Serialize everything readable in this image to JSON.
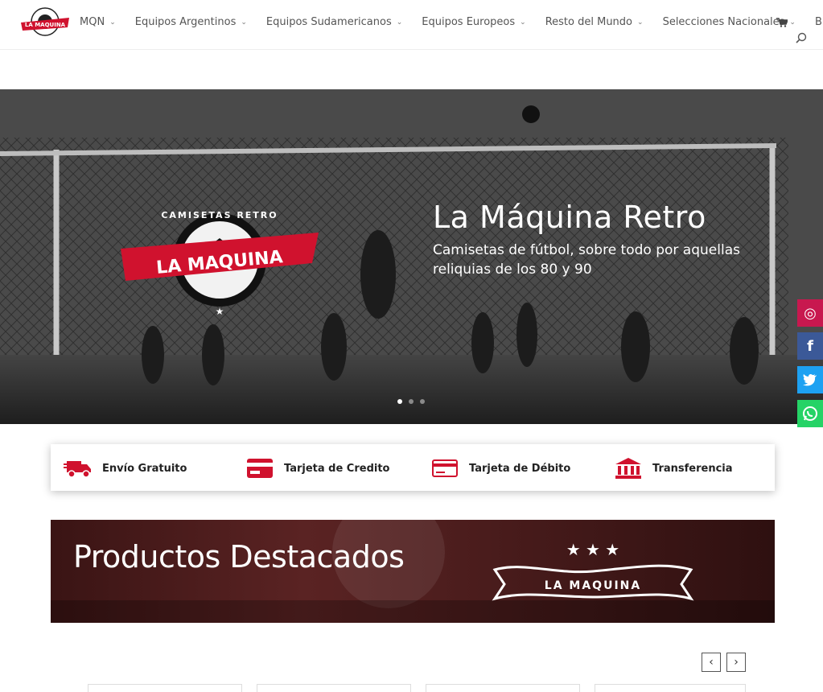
{
  "nav": {
    "items": [
      {
        "label": "MQN",
        "has_dropdown": true
      },
      {
        "label": "Equipos Argentinos",
        "has_dropdown": true
      },
      {
        "label": "Equipos Sudamericanos",
        "has_dropdown": true
      },
      {
        "label": "Equipos Europeos",
        "has_dropdown": true
      },
      {
        "label": "Resto del Mundo",
        "has_dropdown": true
      },
      {
        "label": "Selecciones Nacionales",
        "has_dropdown": true
      }
    ],
    "blog_label": "Blog",
    "cart_icon": "cart-icon",
    "search_icon": "search-icon"
  },
  "hero": {
    "title": "La Máquina Retro",
    "subtitle": "Camisetas de fútbol, sobre todo por aquellas reliquias de los 80 y 90",
    "emblem_text_top": "CAMISETAS RETRO",
    "emblem_banner": "LA MAQUINA",
    "slides": 3,
    "active_slide": 1
  },
  "social": [
    {
      "name": "instagram-icon",
      "glyph": "◎",
      "color": "#c8184f"
    },
    {
      "name": "facebook-icon",
      "glyph": "f",
      "color": "#3b5998"
    },
    {
      "name": "twitter-icon",
      "glyph": "🐦",
      "color": "#1da1f2"
    },
    {
      "name": "whatsapp-icon",
      "glyph": "✆",
      "color": "#25d366"
    }
  ],
  "features": [
    {
      "label": "Envío Gratuito",
      "icon": "truck-icon"
    },
    {
      "label": "Tarjeta de Credito",
      "icon": "credit-card-icon"
    },
    {
      "label": "Tarjeta de Débito",
      "icon": "debit-card-icon"
    },
    {
      "label": "Transferencia",
      "icon": "bank-icon"
    }
  ],
  "featured": {
    "title": "Productos Destacados",
    "logo_text": "LA MAQUINA"
  },
  "carousel": {
    "prev_glyph": "‹",
    "next_glyph": "›"
  },
  "colors": {
    "accent": "#d0122e",
    "nav_text": "#555555"
  }
}
